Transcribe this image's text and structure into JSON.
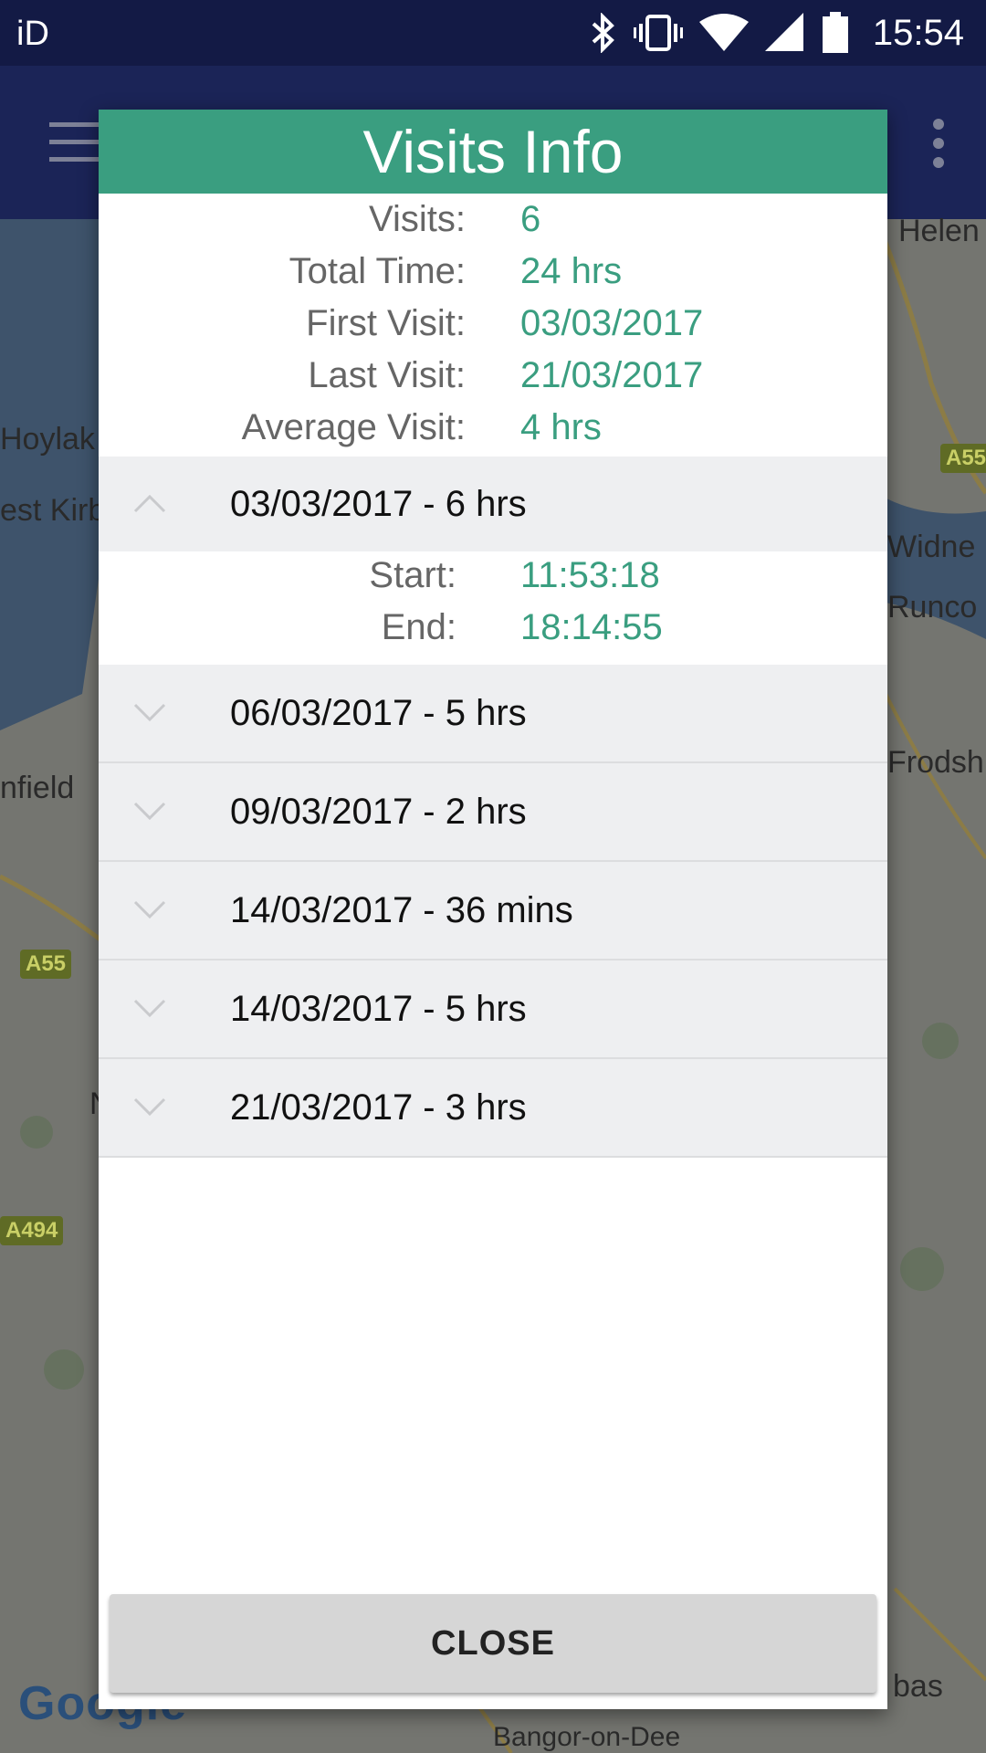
{
  "status_bar": {
    "carrier": "iD",
    "time": "15:54",
    "icons": [
      "bluetooth-icon",
      "vibrate-icon",
      "wifi-icon",
      "signal-icon",
      "battery-icon"
    ]
  },
  "toolbar": {
    "menu_icon": "hamburger-menu-icon",
    "overflow_icon": "more-vert-icon"
  },
  "map": {
    "labels": [
      "Helen",
      "Hoylak",
      "est Kirb",
      "Widne",
      "Runco",
      "Frodsh",
      "nfield",
      "N",
      "Bangor-on-Dee",
      "bas"
    ],
    "road_badges": [
      "A55",
      "A55",
      "A494"
    ],
    "logo": "Google"
  },
  "dialog": {
    "title": "Visits Info",
    "summary": [
      {
        "label": "Visits:",
        "value": "6"
      },
      {
        "label": "Total Time:",
        "value": "24 hrs"
      },
      {
        "label": "First Visit:",
        "value": "03/03/2017"
      },
      {
        "label": "Last Visit:",
        "value": "21/03/2017"
      },
      {
        "label": "Average Visit:",
        "value": "4 hrs"
      }
    ],
    "visits": [
      {
        "title": "03/03/2017 - 6 hrs",
        "expanded": true,
        "details": [
          {
            "label": "Start:",
            "value": "11:53:18"
          },
          {
            "label": "End:",
            "value": "18:14:55"
          }
        ]
      },
      {
        "title": "06/03/2017 - 5 hrs",
        "expanded": false
      },
      {
        "title": "09/03/2017 - 2 hrs",
        "expanded": false
      },
      {
        "title": "14/03/2017 - 36 mins",
        "expanded": false
      },
      {
        "title": "14/03/2017 - 5 hrs",
        "expanded": false
      },
      {
        "title": "21/03/2017 - 3 hrs",
        "expanded": false
      }
    ],
    "close_label": "CLOSE"
  },
  "colors": {
    "accent": "#3a9e80",
    "status_bar": "#131a45",
    "toolbar": "#1b2457",
    "row_background": "#eeeff1"
  }
}
